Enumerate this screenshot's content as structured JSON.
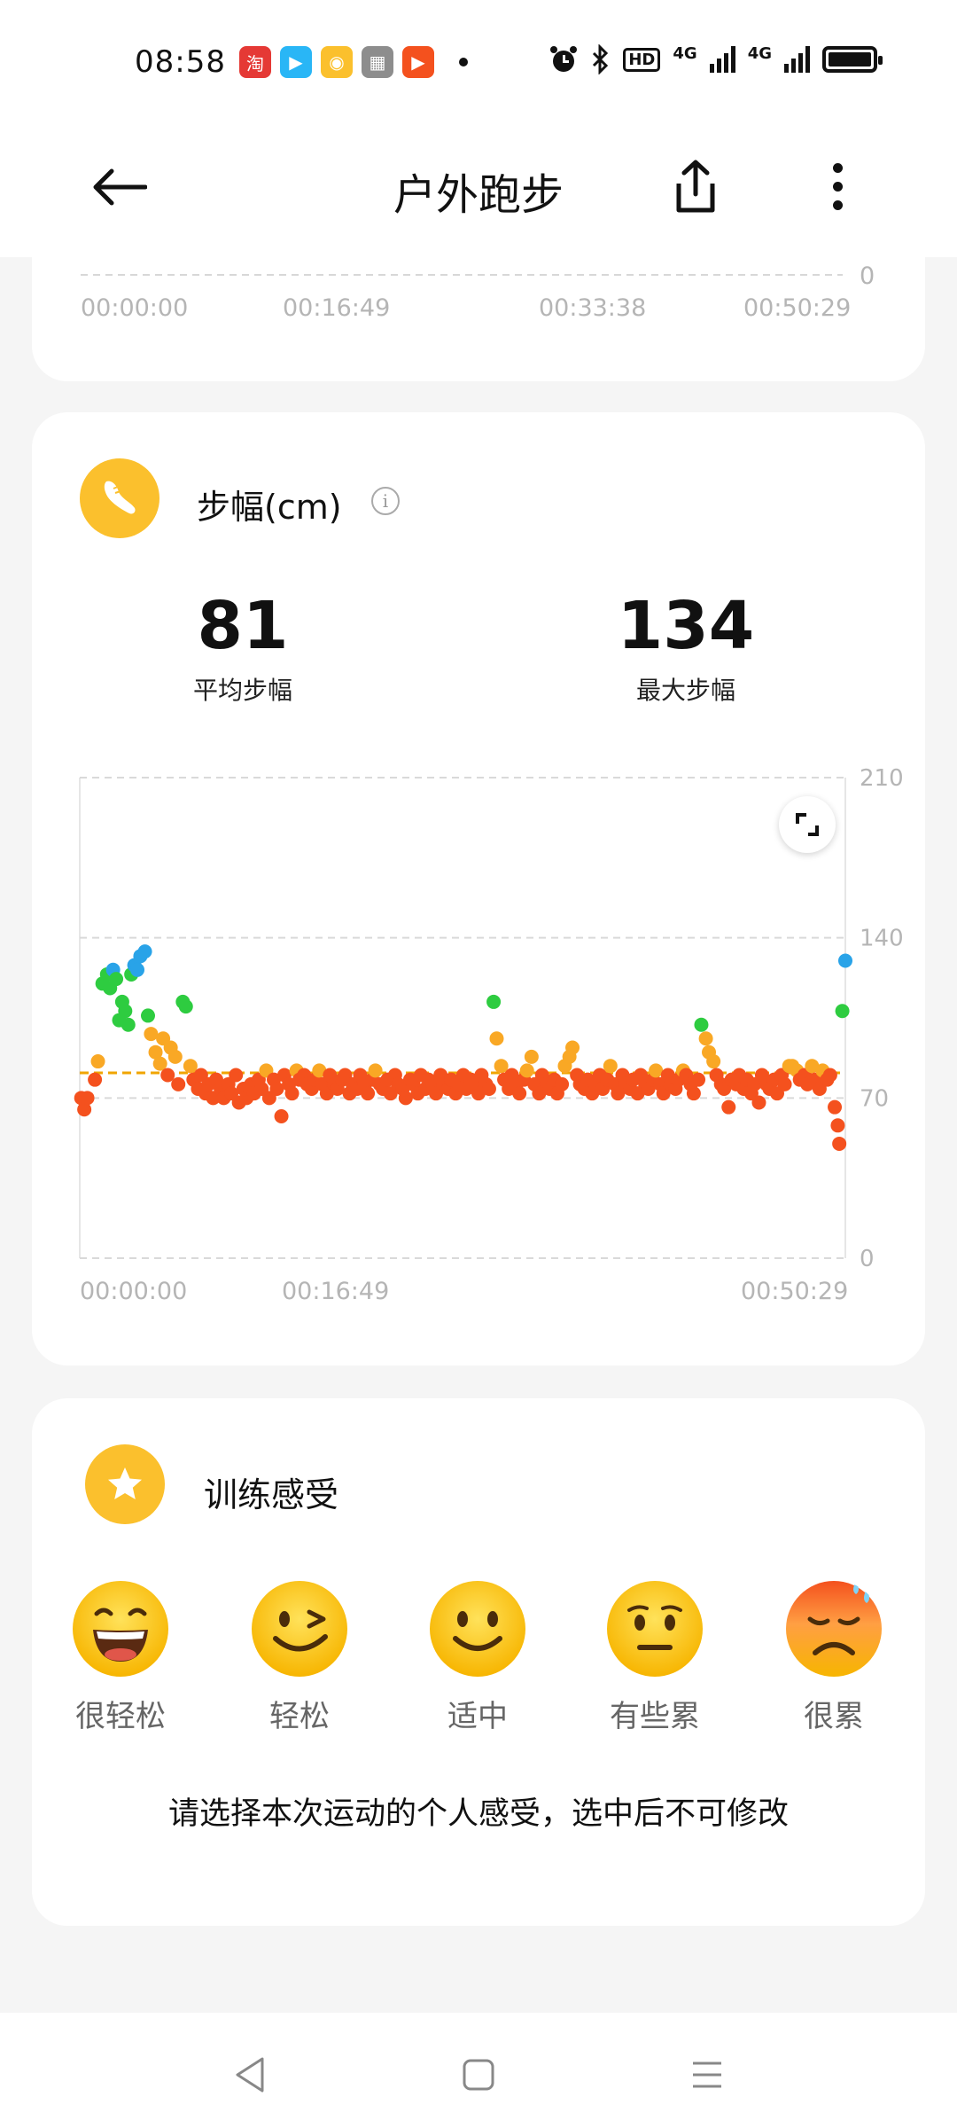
{
  "status_bar": {
    "time": "08:58",
    "app_icons": [
      {
        "name": "taobao-icon",
        "glyph": "淘",
        "color": "#e53935"
      },
      {
        "name": "video-app-icon",
        "glyph": "▶",
        "color": "#29b6f6"
      },
      {
        "name": "weibo-icon",
        "glyph": "◉",
        "color": "#fbc02d"
      },
      {
        "name": "gallery-app-icon",
        "glyph": "▦",
        "color": "#8d8d8d"
      },
      {
        "name": "play-app-icon",
        "glyph": "▶",
        "color": "#f4511e"
      }
    ],
    "hd_label": "HD",
    "network_1": "4G",
    "network_2": "4G"
  },
  "app_bar": {
    "title": "户外跑步"
  },
  "top_card": {
    "x_ticks": [
      "00:00:00",
      "00:16:49",
      "00:33:38",
      "00:50:29"
    ],
    "y_tick": "0"
  },
  "stride_card": {
    "title": "步幅(cm)",
    "info_glyph": "i",
    "avg_value": "81",
    "avg_label": "平均步幅",
    "max_value": "134",
    "max_label": "最大步幅"
  },
  "chart_data": {
    "type": "scatter",
    "title": "步幅(cm)",
    "x_tick_labels": [
      "00:00:00",
      "00:16:49",
      "",
      "00:50:29"
    ],
    "y_tick_labels": [
      "0",
      "70",
      "140",
      "210"
    ],
    "ylim": [
      0,
      210
    ],
    "xlim_minutes": [
      0,
      50.5
    ],
    "grid": "horizontal dashed",
    "reference_line": {
      "label": "average",
      "value": 81,
      "color": "#f0a500"
    },
    "color_scale": {
      "low": "#f4511e",
      "mid": "#f9a825",
      "high": "#2ecc40",
      "top": "#29a3e8"
    },
    "series": [
      {
        "values": [
          [
            0.1,
            70
          ],
          [
            0.3,
            65
          ],
          [
            0.5,
            70
          ],
          [
            1.0,
            78
          ],
          [
            1.2,
            86
          ],
          [
            1.5,
            120
          ],
          [
            1.8,
            124
          ],
          [
            2.0,
            118
          ],
          [
            2.2,
            126
          ],
          [
            2.4,
            122
          ],
          [
            2.6,
            104
          ],
          [
            2.8,
            112
          ],
          [
            3.0,
            108
          ],
          [
            3.2,
            102
          ],
          [
            3.4,
            124
          ],
          [
            3.6,
            128
          ],
          [
            3.8,
            126
          ],
          [
            4.0,
            132
          ],
          [
            4.3,
            134
          ],
          [
            4.5,
            106
          ],
          [
            4.7,
            98
          ],
          [
            5.0,
            90
          ],
          [
            5.3,
            85
          ],
          [
            5.5,
            96
          ],
          [
            5.8,
            80
          ],
          [
            6.0,
            92
          ],
          [
            6.3,
            88
          ],
          [
            6.5,
            76
          ],
          [
            6.8,
            112
          ],
          [
            7.0,
            110
          ],
          [
            7.3,
            84
          ],
          [
            7.5,
            78
          ],
          [
            7.8,
            74
          ],
          [
            8.0,
            80
          ],
          [
            8.3,
            72
          ],
          [
            8.5,
            76
          ],
          [
            8.8,
            70
          ],
          [
            9.0,
            78
          ],
          [
            9.3,
            74
          ],
          [
            9.5,
            70
          ],
          [
            9.8,
            76
          ],
          [
            10.0,
            72
          ],
          [
            10.3,
            80
          ],
          [
            10.5,
            68
          ],
          [
            10.8,
            74
          ],
          [
            11.0,
            70
          ],
          [
            11.3,
            76
          ],
          [
            11.5,
            72
          ],
          [
            11.8,
            78
          ],
          [
            12.0,
            74
          ],
          [
            12.3,
            82
          ],
          [
            12.5,
            70
          ],
          [
            12.8,
            78
          ],
          [
            13.0,
            74
          ],
          [
            13.3,
            62
          ],
          [
            13.5,
            80
          ],
          [
            13.8,
            76
          ],
          [
            14.0,
            72
          ],
          [
            14.3,
            82
          ],
          [
            14.5,
            78
          ],
          [
            14.8,
            80
          ],
          [
            15.0,
            76
          ],
          [
            15.3,
            74
          ],
          [
            15.5,
            78
          ],
          [
            15.8,
            82
          ],
          [
            16.0,
            76
          ],
          [
            16.3,
            72
          ],
          [
            16.5,
            80
          ],
          [
            16.8,
            76
          ],
          [
            17.0,
            74
          ],
          [
            17.3,
            78
          ],
          [
            17.5,
            80
          ],
          [
            17.8,
            72
          ],
          [
            18.0,
            76
          ],
          [
            18.3,
            74
          ],
          [
            18.5,
            80
          ],
          [
            18.8,
            76
          ],
          [
            19.0,
            72
          ],
          [
            19.3,
            78
          ],
          [
            19.5,
            82
          ],
          [
            19.8,
            76
          ],
          [
            20.0,
            74
          ],
          [
            20.3,
            78
          ],
          [
            20.5,
            72
          ],
          [
            20.8,
            80
          ],
          [
            21.0,
            76
          ],
          [
            21.3,
            74
          ],
          [
            21.5,
            70
          ],
          [
            21.8,
            78
          ],
          [
            22.0,
            76
          ],
          [
            22.3,
            72
          ],
          [
            22.5,
            80
          ],
          [
            22.8,
            74
          ],
          [
            23.0,
            78
          ],
          [
            23.3,
            76
          ],
          [
            23.5,
            72
          ],
          [
            23.8,
            80
          ],
          [
            24.0,
            76
          ],
          [
            24.3,
            74
          ],
          [
            24.5,
            78
          ],
          [
            24.8,
            72
          ],
          [
            25.0,
            76
          ],
          [
            25.3,
            80
          ],
          [
            25.5,
            74
          ],
          [
            25.8,
            78
          ],
          [
            26.0,
            76
          ],
          [
            26.3,
            72
          ],
          [
            26.5,
            80
          ],
          [
            26.8,
            76
          ],
          [
            27.0,
            74
          ],
          [
            27.3,
            112
          ],
          [
            27.5,
            96
          ],
          [
            27.8,
            84
          ],
          [
            28.0,
            78
          ],
          [
            28.3,
            74
          ],
          [
            28.5,
            80
          ],
          [
            28.8,
            76
          ],
          [
            29.0,
            72
          ],
          [
            29.3,
            78
          ],
          [
            29.5,
            82
          ],
          [
            29.8,
            88
          ],
          [
            30.0,
            76
          ],
          [
            30.3,
            72
          ],
          [
            30.5,
            80
          ],
          [
            30.8,
            76
          ],
          [
            31.0,
            74
          ],
          [
            31.3,
            78
          ],
          [
            31.5,
            72
          ],
          [
            31.8,
            76
          ],
          [
            32.0,
            84
          ],
          [
            32.3,
            88
          ],
          [
            32.5,
            92
          ],
          [
            32.8,
            80
          ],
          [
            33.0,
            76
          ],
          [
            33.3,
            74
          ],
          [
            33.5,
            78
          ],
          [
            33.8,
            72
          ],
          [
            34.0,
            76
          ],
          [
            34.3,
            80
          ],
          [
            34.5,
            74
          ],
          [
            34.8,
            78
          ],
          [
            35.0,
            84
          ],
          [
            35.3,
            76
          ],
          [
            35.5,
            72
          ],
          [
            35.8,
            80
          ],
          [
            36.0,
            76
          ],
          [
            36.3,
            74
          ],
          [
            36.5,
            78
          ],
          [
            36.8,
            72
          ],
          [
            37.0,
            80
          ],
          [
            37.3,
            76
          ],
          [
            37.5,
            74
          ],
          [
            37.8,
            78
          ],
          [
            38.0,
            82
          ],
          [
            38.3,
            76
          ],
          [
            38.5,
            72
          ],
          [
            38.8,
            80
          ],
          [
            39.0,
            76
          ],
          [
            39.3,
            74
          ],
          [
            39.5,
            78
          ],
          [
            39.8,
            82
          ],
          [
            40.0,
            80
          ],
          [
            40.3,
            76
          ],
          [
            40.5,
            72
          ],
          [
            40.8,
            78
          ],
          [
            41.0,
            102
          ],
          [
            41.3,
            96
          ],
          [
            41.5,
            90
          ],
          [
            41.8,
            86
          ],
          [
            42.0,
            80
          ],
          [
            42.3,
            76
          ],
          [
            42.5,
            74
          ],
          [
            42.8,
            66
          ],
          [
            43.0,
            78
          ],
          [
            43.3,
            76
          ],
          [
            43.5,
            80
          ],
          [
            43.8,
            74
          ],
          [
            44.0,
            78
          ],
          [
            44.3,
            72
          ],
          [
            44.5,
            76
          ],
          [
            44.8,
            68
          ],
          [
            45.0,
            80
          ],
          [
            45.3,
            76
          ],
          [
            45.5,
            74
          ],
          [
            45.8,
            78
          ],
          [
            46.0,
            72
          ],
          [
            46.3,
            80
          ],
          [
            46.5,
            76
          ],
          [
            46.8,
            84
          ],
          [
            47.0,
            84
          ],
          [
            47.3,
            82
          ],
          [
            47.5,
            78
          ],
          [
            47.8,
            80
          ],
          [
            48.0,
            76
          ],
          [
            48.3,
            84
          ],
          [
            48.5,
            78
          ],
          [
            48.8,
            74
          ],
          [
            49.0,
            82
          ],
          [
            49.3,
            78
          ],
          [
            49.5,
            80
          ],
          [
            49.8,
            66
          ],
          [
            50.0,
            58
          ],
          [
            50.1,
            50
          ],
          [
            50.3,
            108
          ],
          [
            50.5,
            130
          ]
        ]
      }
    ]
  },
  "feel_card": {
    "title": "训练感受",
    "options": [
      {
        "label": "很轻松"
      },
      {
        "label": "轻松"
      },
      {
        "label": "适中"
      },
      {
        "label": "有些累"
      },
      {
        "label": "很累"
      }
    ],
    "hint": "请选择本次运动的个人感受，选中后不可修改"
  }
}
